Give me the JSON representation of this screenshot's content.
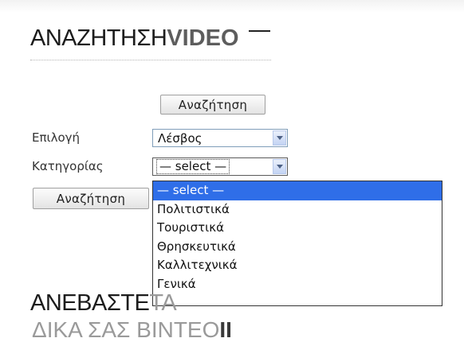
{
  "search_section": {
    "title_regular": "ΑΝΑΖΗΤΗΣΗ",
    "title_bold": "VIDEO",
    "top_button_label": "Αναζήτηση",
    "left_button_label": "Αναζήτηση"
  },
  "form": {
    "selection_label": "Επιλογή",
    "selection_value": "Λέσβος",
    "category_label": "Κατηγορίας",
    "category_value": "— select —"
  },
  "dropdown": {
    "options": [
      {
        "label": "— select —",
        "selected": true
      },
      {
        "label": "Πολιτιστικά",
        "selected": false
      },
      {
        "label": "Τουριστικά",
        "selected": false
      },
      {
        "label": "Θρησκευτικά",
        "selected": false
      },
      {
        "label": "Καλλιτεχνικά",
        "selected": false
      },
      {
        "label": "Γενικά",
        "selected": false
      }
    ]
  },
  "upload_section": {
    "heading_part1": "ΑΝΕΒΑΣΤΕ",
    "heading_part2": "ΤΑ",
    "partial_next_line": "ΔΙΚΑ ΣΑΣ ΒΙΝΤΕΟ",
    "partial_next_line_bold": "II"
  },
  "colors": {
    "selected_highlight": "#2f6ee8",
    "heading_bold_gray": "#5d5d5d"
  }
}
